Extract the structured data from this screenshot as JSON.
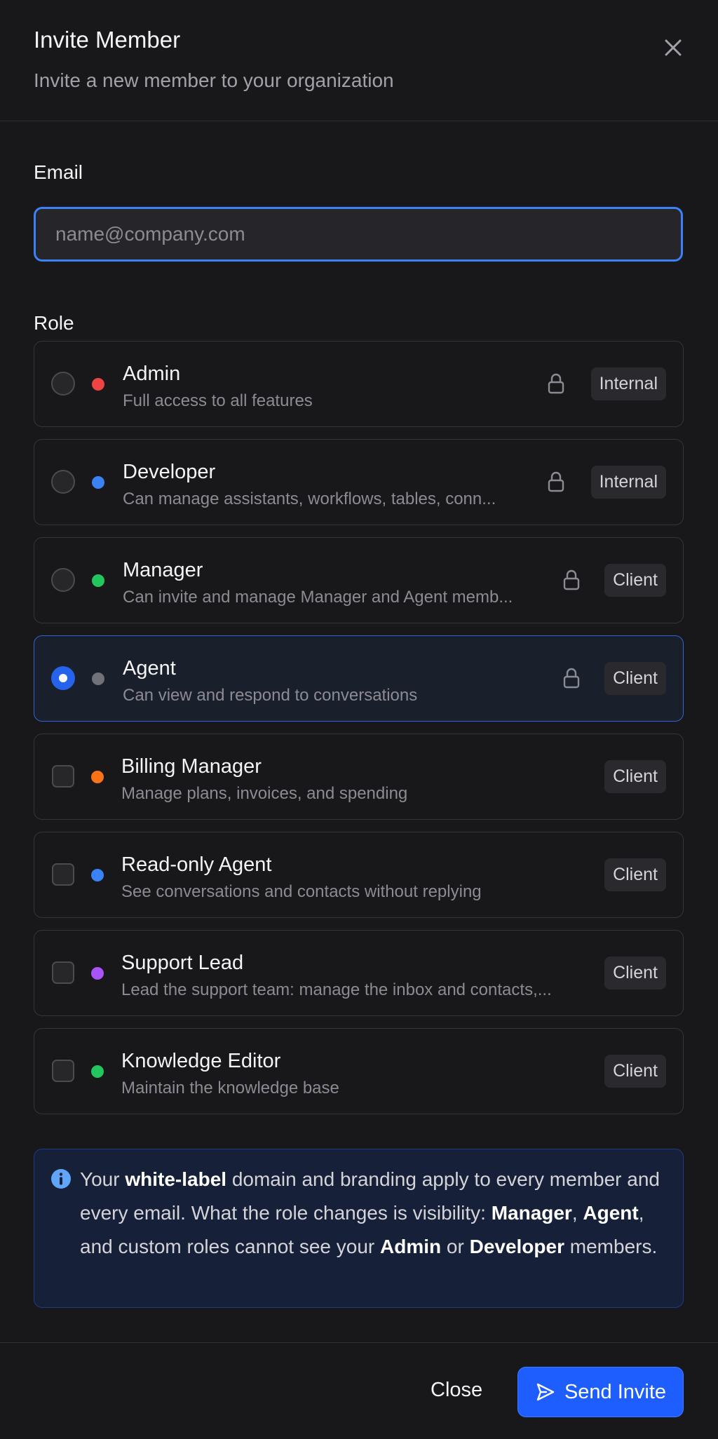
{
  "dialog": {
    "title": "Invite Member",
    "subtitle": "Invite a new member to your organization",
    "close_icon": "x-icon"
  },
  "email": {
    "label": "Email",
    "value": "",
    "placeholder": "name@company.com"
  },
  "role": {
    "label": "Role",
    "selected": "Agent",
    "items": [
      {
        "name": "Admin",
        "description": "Full access to all features",
        "badge": "Internal",
        "control": "radio",
        "locked": true,
        "dot_color": "#ef4444",
        "selected": false
      },
      {
        "name": "Developer",
        "description": "Can manage assistants, workflows, tables, conn...",
        "badge": "Internal",
        "control": "radio",
        "locked": true,
        "dot_color": "#3b82f6",
        "selected": false
      },
      {
        "name": "Manager",
        "description": "Can invite and manage Manager and Agent memb...",
        "badge": "Client",
        "control": "radio",
        "locked": true,
        "dot_color": "#22c55e",
        "selected": false
      },
      {
        "name": "Agent",
        "description": "Can view and respond to conversations",
        "badge": "Client",
        "control": "radio",
        "locked": true,
        "dot_color": "#71717a",
        "selected": true
      },
      {
        "name": "Billing Manager",
        "description": "Manage plans, invoices, and spending",
        "badge": "Client",
        "control": "checkbox",
        "locked": false,
        "dot_color": "#f97316",
        "selected": false
      },
      {
        "name": "Read-only Agent",
        "description": "See conversations and contacts without replying",
        "badge": "Client",
        "control": "checkbox",
        "locked": false,
        "dot_color": "#3b82f6",
        "selected": false
      },
      {
        "name": "Support Lead",
        "description": "Lead the support team: manage the inbox and contacts,...",
        "badge": "Client",
        "control": "checkbox",
        "locked": false,
        "dot_color": "#a855f7",
        "selected": false
      },
      {
        "name": "Knowledge Editor",
        "description": "Maintain the knowledge base",
        "badge": "Client",
        "control": "checkbox",
        "locked": false,
        "dot_color": "#22c55e",
        "selected": false
      }
    ]
  },
  "info": {
    "icon": "info-icon",
    "parts": [
      {
        "text": "Your ",
        "bold": false
      },
      {
        "text": "white-label",
        "bold": true
      },
      {
        "text": " domain and branding apply to every member and every email. What the role changes is visibility: ",
        "bold": false
      },
      {
        "text": "Manager",
        "bold": true
      },
      {
        "text": ", ",
        "bold": false
      },
      {
        "text": "Agent",
        "bold": true
      },
      {
        "text": ", and custom roles cannot see your ",
        "bold": false
      },
      {
        "text": "Admin",
        "bold": true
      },
      {
        "text": " or ",
        "bold": false
      },
      {
        "text": "Developer",
        "bold": true
      },
      {
        "text": " members.",
        "bold": false
      }
    ]
  },
  "footer": {
    "close_label": "Close",
    "send_label": "Send Invite",
    "send_icon": "send-icon"
  },
  "colors": {
    "accent": "#1e5eff",
    "background": "#18181b",
    "info_background": "#162038"
  }
}
